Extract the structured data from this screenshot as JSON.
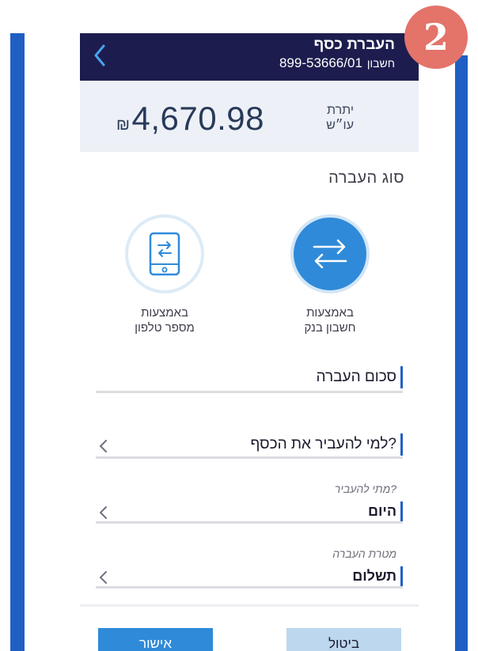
{
  "step_badge": "2",
  "header": {
    "title": "העברת כסף",
    "account_label": "חשבון",
    "account_number": "899-53666/01"
  },
  "balance": {
    "amount": "4,670.98",
    "currency": "₪",
    "label_line1": "יתרת",
    "label_line2": "עו״ש"
  },
  "transfer_type": {
    "title": "סוג העברה",
    "options": [
      {
        "line1": "באמצעות",
        "line2": "חשבון בנק",
        "selected": true,
        "icon": "arrows-swap-icon"
      },
      {
        "line1": "באמצעות",
        "line2": "מספר טלפון",
        "selected": false,
        "icon": "phone-swap-icon"
      }
    ]
  },
  "fields": {
    "amount_label": "סכום העברה",
    "recipient_label": "למי להעביר את הכסף?",
    "when_label": "מתי להעביר?",
    "when_value": "היום",
    "purpose_label": "מטרת העברה",
    "purpose_value": "תשלום"
  },
  "buttons": {
    "confirm": "אישור",
    "cancel": "ביטול"
  },
  "colors": {
    "header_bg": "#1c1d4e",
    "accent_blue": "#2f8ad9",
    "frame_blue": "#1f5fc4",
    "badge": "#e4736a"
  }
}
